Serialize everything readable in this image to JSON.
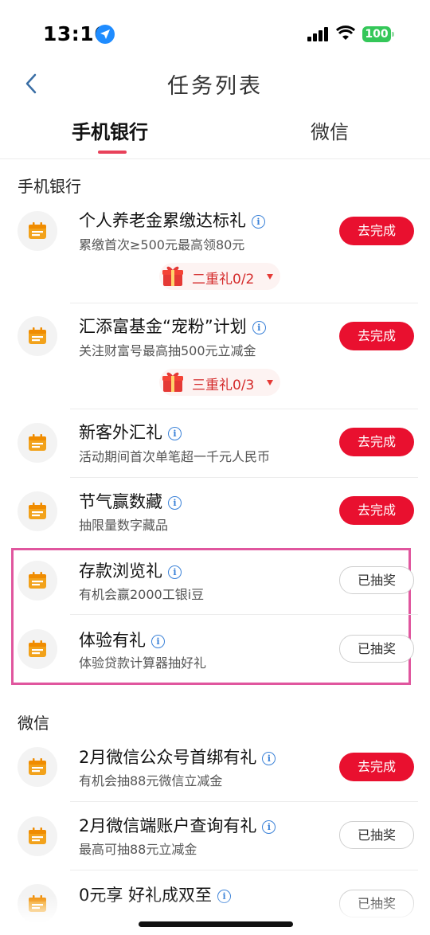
{
  "status": {
    "time": "13:16",
    "battery": "100"
  },
  "nav": {
    "title": "任务列表"
  },
  "tabs": [
    {
      "label": "手机银行",
      "active": true
    },
    {
      "label": "微信",
      "active": false
    }
  ],
  "sections": {
    "bank": "手机银行",
    "wechat": "微信"
  },
  "tasks": [
    {
      "title": "个人养老金累缴达标礼",
      "desc": "累缴首次≥500元最高领80元",
      "button": "去完成",
      "gift": "二重礼0/2"
    },
    {
      "title": "汇添富基金“宠粉”计划",
      "desc": "关注财富号最高抽500元立减金",
      "button": "去完成",
      "gift": "三重礼0/3"
    },
    {
      "title": "新客外汇礼",
      "desc": "活动期间首次单笔超一千元人民币",
      "button": "去完成"
    },
    {
      "title": "节气赢数藏",
      "desc": "抽限量数字藏品",
      "button": "去完成"
    },
    {
      "title": "存款浏览礼",
      "desc": "有机会赢2000工银i豆",
      "button": "已抽奖"
    },
    {
      "title": "体验有礼",
      "desc": "体验贷款计算器抽好礼",
      "button": "已抽奖"
    },
    {
      "title": "2月微信公众号首绑有礼",
      "desc": "有机会抽88元微信立减金",
      "button": "去完成"
    },
    {
      "title": "2月微信端账户查询有礼",
      "desc": "最高可抽88元立减金",
      "button": "已抽奖"
    },
    {
      "title": "0元享 好礼成双至",
      "button": "已抽奖"
    }
  ],
  "colors": {
    "accent": "#e9102f",
    "highlight": "#e0569e",
    "tab_underline": "#e8415a"
  }
}
